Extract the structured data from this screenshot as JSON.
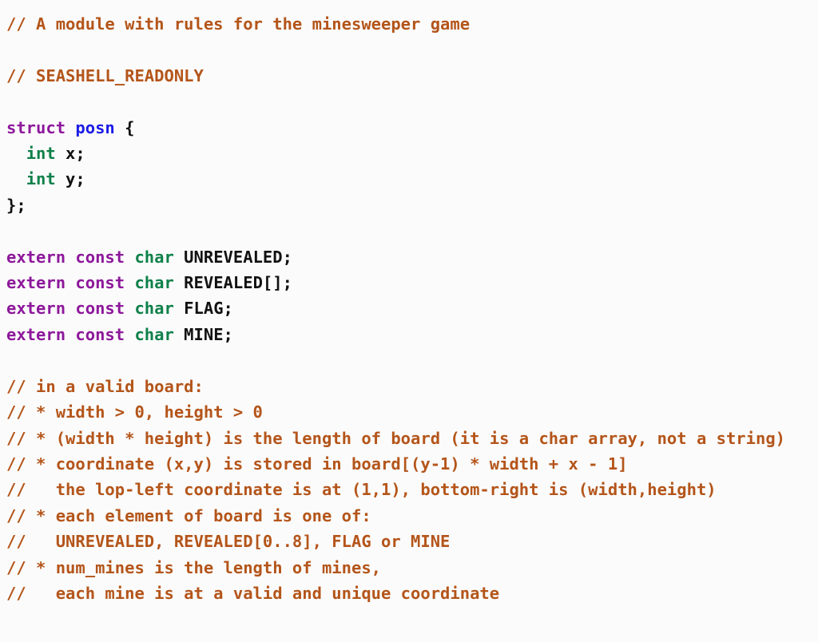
{
  "editor": {
    "language": "C",
    "background_color": "#fbfbfb",
    "syntax_colors": {
      "comment": "#b4551a",
      "keyword": "#8d189b",
      "type": "#0e8049",
      "type_name": "#1c1ce6",
      "identifier": "#111111"
    },
    "full_text": "// A module with rules for the minesweeper game\n\n// SEASHELL_READONLY\n\nstruct posn {\n  int x;\n  int y;\n};\n\nextern const char UNREVEALED;\nextern const char REVEALED[];\nextern const char FLAG;\nextern const char MINE;\n\n// in a valid board:\n// * width > 0, height > 0\n// * (width * height) is the length of board (it is a char array, not a string)\n// * coordinate (x,y) is stored in board[(y-1) * width + x - 1]\n//   the lop-left coordinate is at (1,1), bottom-right is (width,height)\n// * each element of board is one of:\n//   UNREVEALED, REVEALED[0..8], FLAG or MINE\n// * num_mines is the length of mines,\n//   each mine is at a valid and unique coordinate",
    "lines": [
      {
        "id": "line-1",
        "kind": "comment",
        "tokens": [
          {
            "cls": "tok-comment",
            "text": "// A module with rules for the minesweeper game"
          }
        ]
      },
      {
        "id": "line-2",
        "kind": "blank",
        "tokens": []
      },
      {
        "id": "line-3",
        "kind": "comment",
        "tokens": [
          {
            "cls": "tok-comment",
            "text": "// SEASHELL_READONLY"
          }
        ]
      },
      {
        "id": "line-4",
        "kind": "blank",
        "tokens": []
      },
      {
        "id": "line-5",
        "kind": "code",
        "tokens": [
          {
            "cls": "tok-keyword",
            "text": "struct"
          },
          {
            "cls": "tok-plain",
            "text": " "
          },
          {
            "cls": "tok-typename",
            "text": "posn"
          },
          {
            "cls": "tok-punct",
            "text": " {"
          }
        ]
      },
      {
        "id": "line-6",
        "kind": "code",
        "tokens": [
          {
            "cls": "tok-plain",
            "text": "  "
          },
          {
            "cls": "tok-type",
            "text": "int"
          },
          {
            "cls": "tok-plain",
            "text": " x;"
          }
        ]
      },
      {
        "id": "line-7",
        "kind": "code",
        "tokens": [
          {
            "cls": "tok-plain",
            "text": "  "
          },
          {
            "cls": "tok-type",
            "text": "int"
          },
          {
            "cls": "tok-plain",
            "text": " y;"
          }
        ]
      },
      {
        "id": "line-8",
        "kind": "code",
        "tokens": [
          {
            "cls": "tok-punct",
            "text": "};"
          }
        ]
      },
      {
        "id": "line-9",
        "kind": "blank",
        "tokens": []
      },
      {
        "id": "line-10",
        "kind": "code",
        "tokens": [
          {
            "cls": "tok-keyword",
            "text": "extern const"
          },
          {
            "cls": "tok-plain",
            "text": " "
          },
          {
            "cls": "tok-type",
            "text": "char"
          },
          {
            "cls": "tok-plain",
            "text": " UNREVEALED;"
          }
        ]
      },
      {
        "id": "line-11",
        "kind": "code",
        "tokens": [
          {
            "cls": "tok-keyword",
            "text": "extern const"
          },
          {
            "cls": "tok-plain",
            "text": " "
          },
          {
            "cls": "tok-type",
            "text": "char"
          },
          {
            "cls": "tok-plain",
            "text": " REVEALED[];"
          }
        ]
      },
      {
        "id": "line-12",
        "kind": "code",
        "tokens": [
          {
            "cls": "tok-keyword",
            "text": "extern const"
          },
          {
            "cls": "tok-plain",
            "text": " "
          },
          {
            "cls": "tok-type",
            "text": "char"
          },
          {
            "cls": "tok-plain",
            "text": " FLAG;"
          }
        ]
      },
      {
        "id": "line-13",
        "kind": "code",
        "tokens": [
          {
            "cls": "tok-keyword",
            "text": "extern const"
          },
          {
            "cls": "tok-plain",
            "text": " "
          },
          {
            "cls": "tok-type",
            "text": "char"
          },
          {
            "cls": "tok-plain",
            "text": " MINE;"
          }
        ]
      },
      {
        "id": "line-14",
        "kind": "blank",
        "tokens": []
      },
      {
        "id": "line-15",
        "kind": "comment",
        "tokens": [
          {
            "cls": "tok-comment",
            "text": "// in a valid board:"
          }
        ]
      },
      {
        "id": "line-16",
        "kind": "comment",
        "tokens": [
          {
            "cls": "tok-comment",
            "text": "// * width > 0, height > 0"
          }
        ]
      },
      {
        "id": "line-17",
        "kind": "comment",
        "wrapped": true,
        "tokens": [
          {
            "cls": "tok-comment",
            "text": "// * (width * height) is the length of board (it is a char array, not a string)"
          }
        ]
      },
      {
        "id": "line-18",
        "kind": "comment",
        "tokens": [
          {
            "cls": "tok-comment",
            "text": "// * coordinate (x,y) is stored in board[(y-1) * width + x - 1]"
          }
        ]
      },
      {
        "id": "line-19",
        "kind": "comment",
        "tokens": [
          {
            "cls": "tok-comment",
            "text": "//   the lop-left coordinate is at (1,1), bottom-right is (width,height)"
          }
        ]
      },
      {
        "id": "line-20",
        "kind": "comment",
        "tokens": [
          {
            "cls": "tok-comment",
            "text": "// * each element of board is one of:"
          }
        ]
      },
      {
        "id": "line-21",
        "kind": "comment",
        "tokens": [
          {
            "cls": "tok-comment",
            "text": "//   UNREVEALED, REVEALED[0..8], FLAG or MINE"
          }
        ]
      },
      {
        "id": "line-22",
        "kind": "comment",
        "tokens": [
          {
            "cls": "tok-comment",
            "text": "// * num_mines is the length of mines,"
          }
        ]
      },
      {
        "id": "line-23",
        "kind": "comment",
        "tokens": [
          {
            "cls": "tok-comment",
            "text": "//   each mine is at a valid and unique coordinate"
          }
        ]
      }
    ]
  }
}
